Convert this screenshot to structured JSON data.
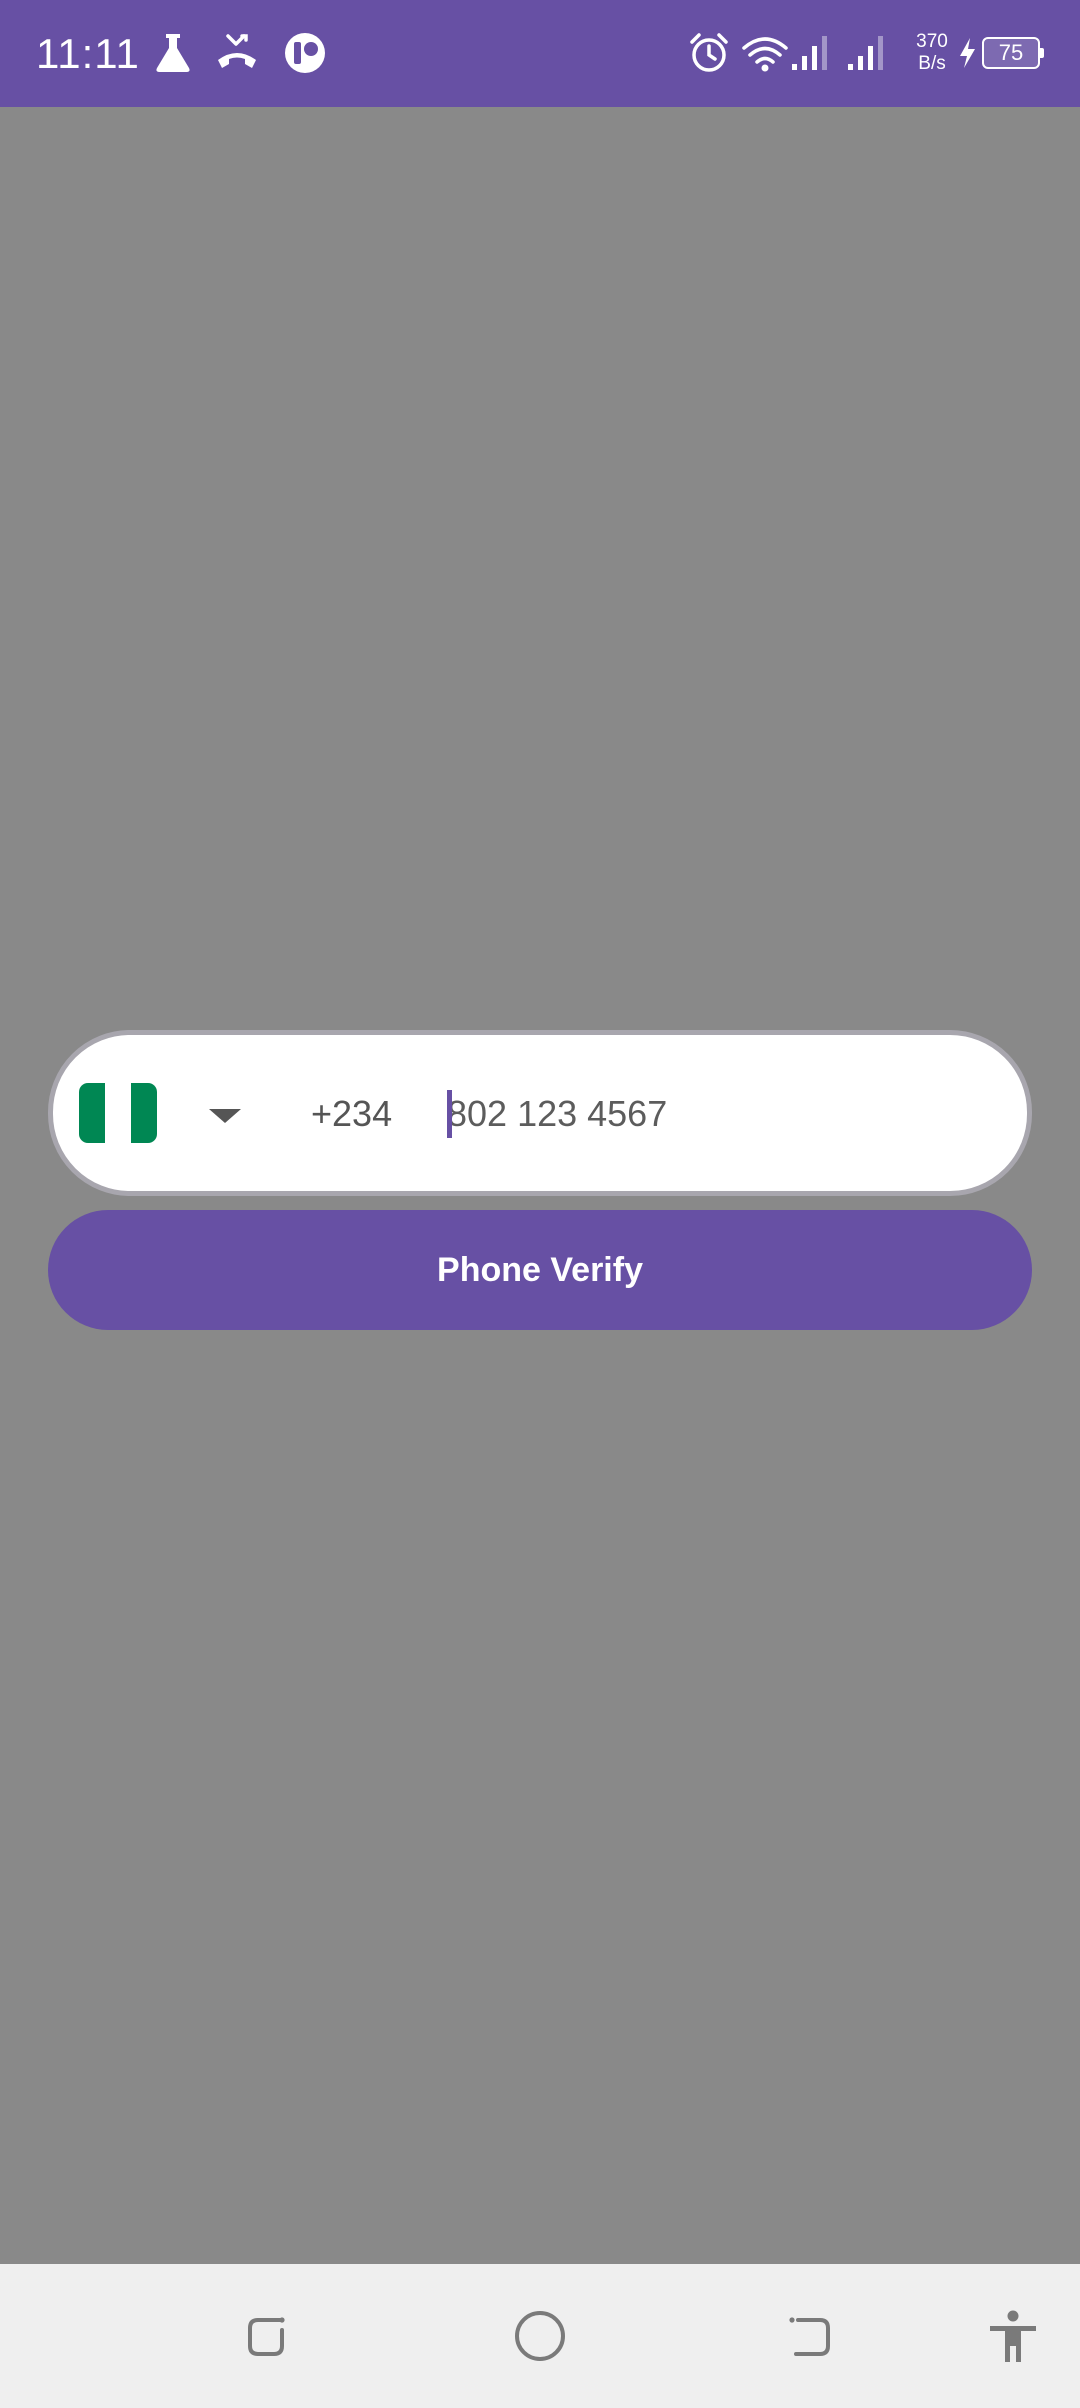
{
  "status_bar": {
    "time": "11:11",
    "net_speed_value": "370",
    "net_speed_unit": "B/s",
    "battery_level": "75",
    "icons": [
      "flask-icon",
      "missed-call-icon",
      "app-notification-icon",
      "alarm-icon",
      "wifi-icon",
      "signal-icon",
      "signal-icon",
      "charging-icon"
    ]
  },
  "phone_form": {
    "country_flag": "nigeria-flag",
    "dial_code": "+234",
    "phone_placeholder": "802 123 4567",
    "phone_value": ""
  },
  "verify_button": {
    "label": "Phone Verify"
  },
  "nav_bar": {
    "icons": [
      "recents-icon",
      "home-icon",
      "back-icon",
      "accessibility-icon"
    ]
  },
  "colors": {
    "accent": "#6750a4",
    "scrim_background": "#898989",
    "card_background": "#ffffff",
    "flag_green": "#008753",
    "nav_background": "#efefef"
  }
}
